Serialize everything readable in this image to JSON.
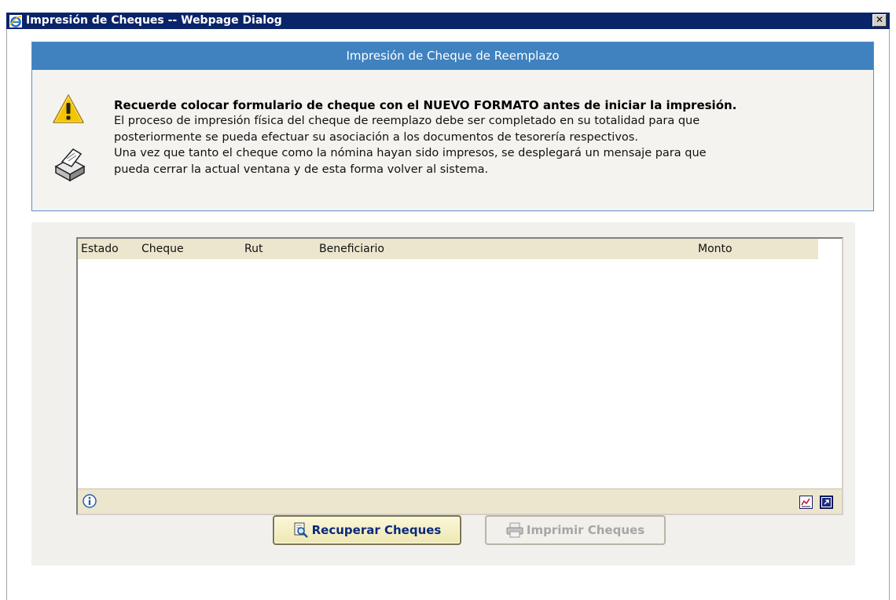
{
  "window": {
    "title": "Impresión de Cheques -- Webpage Dialog",
    "close_label": "✕"
  },
  "panel": {
    "header": "Impresión de Cheque de Reemplazo",
    "bold_message": "Recuerde colocar formulario de cheque con el NUEVO FORMATO antes de iniciar la impresión.",
    "lines": [
      "El proceso de impresión física del cheque de reemplazo debe ser completado en su totalidad para que",
      "posteriormente se pueda efectuar su asociación a los documentos de tesorería respectivos.",
      "Una vez que tanto el cheque como la nómina hayan sido impresos, se desplegará un mensaje para que",
      "pueda cerrar la actual ventana y de esta forma volver al sistema."
    ],
    "icons": [
      "warning-icon",
      "printer-icon"
    ]
  },
  "grid": {
    "columns": [
      "Estado",
      "Cheque",
      "Rut",
      "Beneficiario",
      "Monto"
    ],
    "rows": [],
    "footer_icons": [
      "info-icon",
      "chart-icon",
      "expand-icon"
    ]
  },
  "buttons": {
    "recuperar": "Recuperar Cheques",
    "imprimir": "Imprimir Cheques"
  },
  "colors": {
    "titlebar": "#0a246a",
    "panel_header": "#3f82bf",
    "grid_header": "#ebe6cd",
    "button_text": "#0b2a7a"
  }
}
